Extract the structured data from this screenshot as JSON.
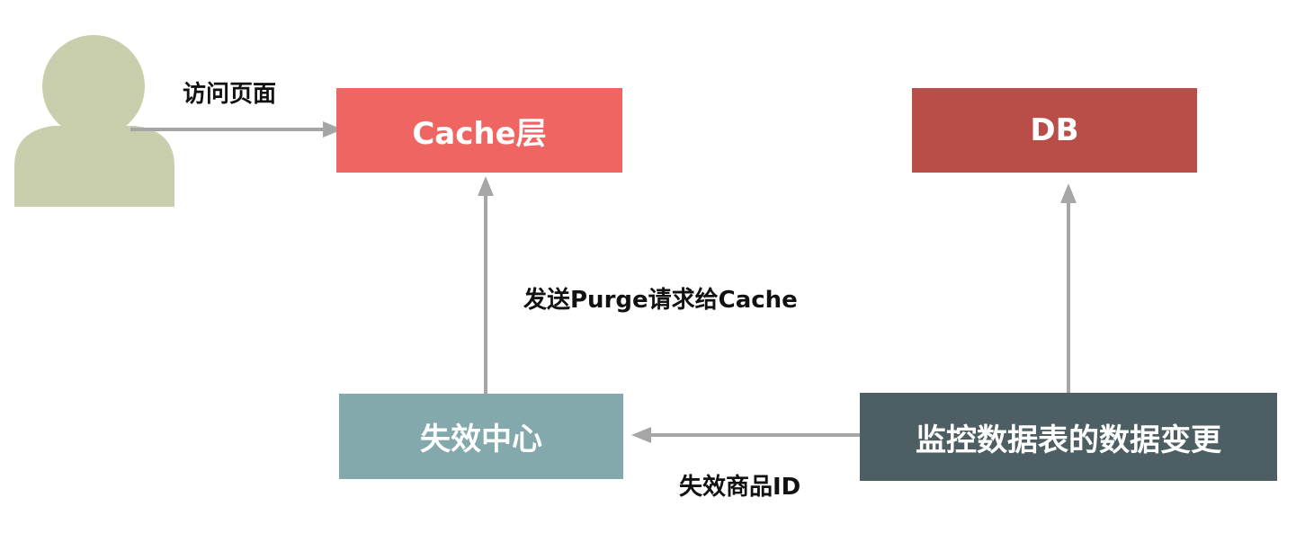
{
  "nodes": {
    "cache": {
      "label": "Cache层",
      "color": "#EF6561"
    },
    "db": {
      "label": "DB",
      "color": "#B94E48"
    },
    "invalidation_center": {
      "label": "失效中心",
      "color": "#84A9AC"
    },
    "data_change_monitor": {
      "label": "监控数据表的数据变更",
      "color": "#4E5F63"
    }
  },
  "edges": {
    "visit_page": "访问页面",
    "purge_request": "发送Purge请求给Cache",
    "invalidate_product_id": "失效商品ID"
  },
  "colors": {
    "user": "#C9CEAC",
    "arrow": "#A6A6A6"
  },
  "icons": {
    "user": "user-icon"
  }
}
